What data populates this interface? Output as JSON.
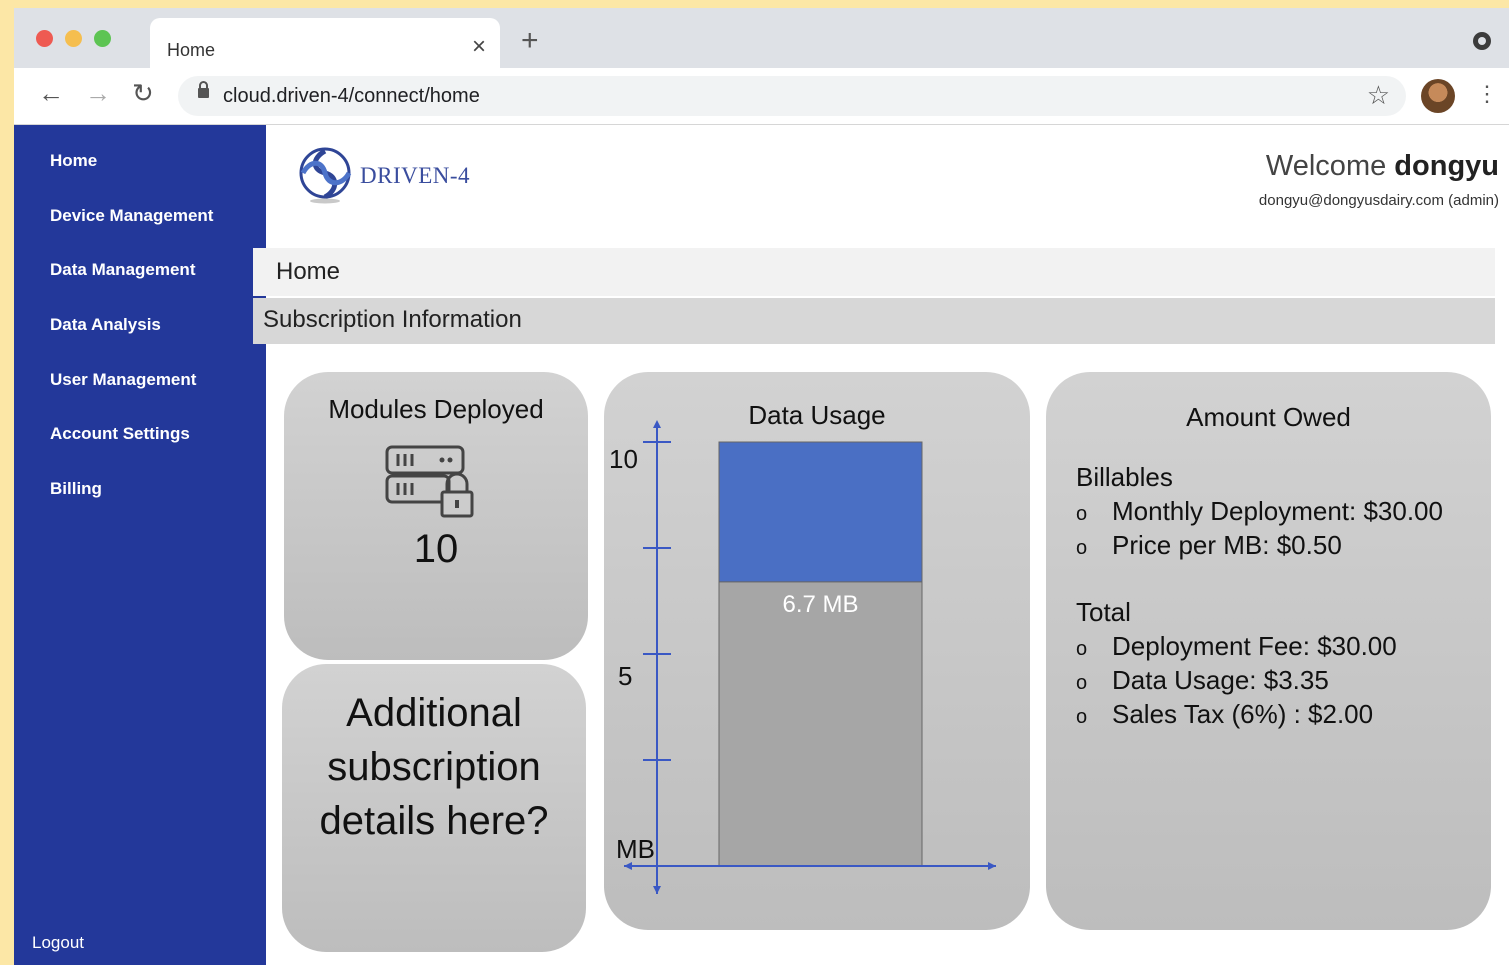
{
  "browser": {
    "tab_title": "Home",
    "tab_close": "×",
    "new_tab": "+",
    "url": "cloud.driven-4/connect/home",
    "back": "←",
    "forward": "→",
    "reload": "↻",
    "bookmark": "☆",
    "menu": "⋮"
  },
  "sidebar": {
    "items": [
      {
        "label": "Home"
      },
      {
        "label": "Device Management"
      },
      {
        "label": "Data Management"
      },
      {
        "label": "Data Analysis"
      },
      {
        "label": "User Management"
      },
      {
        "label": "Account Settings"
      },
      {
        "label": "Billing"
      }
    ],
    "logout": "Logout"
  },
  "header": {
    "logo_text": "DRIVEN-4",
    "welcome_prefix": "Welcome",
    "username": "dongyu",
    "email": "dongyu@dongyusdairy.com (admin)"
  },
  "page": {
    "breadcrumb": "Home",
    "section_title": "Subscription Information"
  },
  "modules": {
    "title": "Modules Deployed",
    "value": "10",
    "icon": "server-lock-icon"
  },
  "additional": {
    "text": "Additional subscription details here?"
  },
  "chart_data": {
    "type": "bar",
    "title": "Data Usage",
    "ylabel": "MB",
    "ylim": [
      0,
      10
    ],
    "yticks": [
      "10",
      "5"
    ],
    "capacity": 10,
    "used": 6.7,
    "used_label": "6.7 MB",
    "colors": {
      "used": "#a6a6a6",
      "remaining": "#4a6fc4",
      "axis": "#3a58c4"
    }
  },
  "owed": {
    "title": "Amount Owed",
    "billables_heading": "Billables",
    "billables": [
      "Monthly Deployment: $30.00",
      "Price per MB: $0.50"
    ],
    "total_heading": "Total",
    "totals": [
      "Deployment Fee: $30.00",
      "Data Usage: $3.35",
      "Sales Tax (6%) : $2.00"
    ],
    "bullet": "o"
  },
  "colors": {
    "sidebar": "#23389a",
    "page_background": "#fce7a6"
  }
}
